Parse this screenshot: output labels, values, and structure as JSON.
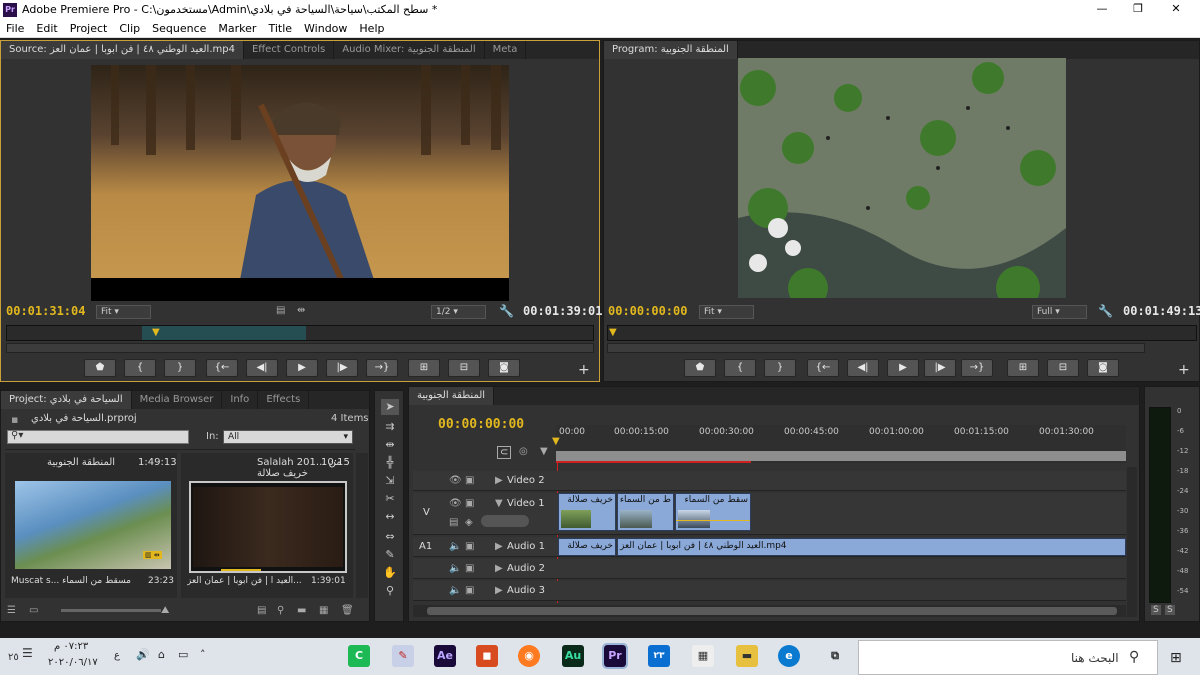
{
  "window": {
    "app_badge": "Pr",
    "title": "Adobe Premiere Pro - C:\\مستخدمون\\Admin\\سطح المكتب\\سياحة\\السياحة في بلادي *",
    "min": "—",
    "max": "❐",
    "close": "✕"
  },
  "menu": [
    "File",
    "Edit",
    "Project",
    "Clip",
    "Sequence",
    "Marker",
    "Title",
    "Window",
    "Help"
  ],
  "source": {
    "tabs": [
      "Source: العيد الوطني ٤٨ | فن ابوبا | عمان العز.mp4",
      "Effect Controls",
      "Audio Mixer: المنطقة الجنوبية",
      "Meta"
    ],
    "timecode_in": "00:01:31:04",
    "fit": "Fit",
    "resolution": "1/2",
    "timecode_dur": "00:01:39:01"
  },
  "program": {
    "tab": "Program: المنطقة الجنوبية",
    "timecode_in": "00:00:00:00",
    "fit": "Fit",
    "resolution": "Full",
    "timecode_dur": "00:01:49:13"
  },
  "project": {
    "tabs": [
      "Project: السياحة في بلادي",
      "Media Browser",
      "Info",
      "Effects"
    ],
    "file": "السياحة في بلادي.prproj",
    "items_count": "4 Items",
    "in_label": "In:",
    "in_value": "All",
    "items": [
      {
        "name": "المنطقة الجنوبية",
        "dur": "1:49:13",
        "thumb_caption": "Muscat s... مسقط من السماء",
        "thumb_dur": "23:23"
      },
      {
        "name": "Salalah 201... من خريف صلالة",
        "dur": "10:15",
        "thumb_caption": "العيد ا | فن ابوبا | عمان العز...",
        "thumb_dur": "1:39:01"
      }
    ]
  },
  "timeline": {
    "tab": "المنطقة الجنوبية",
    "timecode": "00:00:00:00",
    "ruler": [
      "00:00",
      "00:00:15:00",
      "00:00:30:00",
      "00:00:45:00",
      "00:01:00:00",
      "00:01:15:00",
      "00:01:30:00"
    ],
    "tracks": {
      "v2": "Video 2",
      "v1": "Video 1",
      "a1": "Audio 1",
      "a2": "Audio 2",
      "a3": "Audio 3",
      "v_tag": "V",
      "a_tag": "A1"
    },
    "clips": {
      "v1": [
        "خريف صلالة",
        "ط من السماء",
        "سقط من السماء"
      ],
      "a1_first": "خريف صلالة",
      "a1_second": "العيد الوطني ٤٨ | فن ابوبا | عمان العز.mp4"
    }
  },
  "meter": {
    "labels": [
      "0",
      "-6",
      "-12",
      "-18",
      "-24",
      "-30",
      "-36",
      "-42",
      "-48",
      "-54"
    ],
    "s": "S"
  },
  "taskbar": {
    "search": "البحث هنا",
    "time": "٠٧:٢٣ م",
    "date": "٢٠٢٠/٠٦/١٧",
    "lang": "ع",
    "notif": "٢٥",
    "mail_badge": "٢٣"
  },
  "colors": {
    "accent": "#e2b81e",
    "clip": "#8aa9d8",
    "panel": "#323232"
  }
}
